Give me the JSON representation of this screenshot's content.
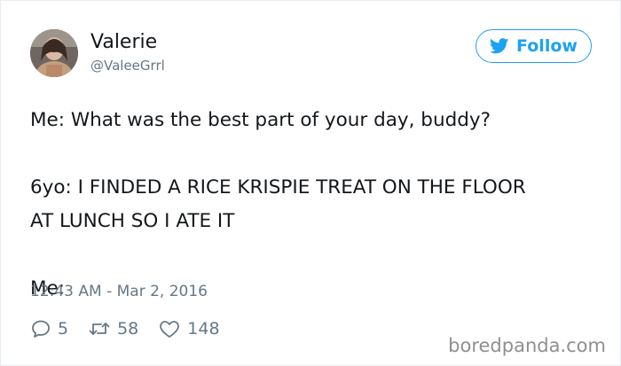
{
  "user": {
    "display_name": "Valerie",
    "handle": "@ValeeGrrl"
  },
  "follow_button": {
    "label": "Follow",
    "icon": "twitter-bird-icon"
  },
  "tweet": {
    "line1": "Me: What was the best part of your day, buddy?",
    "line2": "6yo: I FINDED A RICE KRISPIE TREAT ON THE FLOOR",
    "line3": "AT LUNCH SO I ATE IT",
    "line4": "Me:"
  },
  "timestamp": "12:43 AM - Mar 2, 2016",
  "actions": {
    "replies": "5",
    "retweets": "58",
    "likes": "148"
  },
  "watermark": "boredpanda.com",
  "colors": {
    "accent": "#1da1f2",
    "text": "#14171a",
    "muted": "#657786"
  }
}
